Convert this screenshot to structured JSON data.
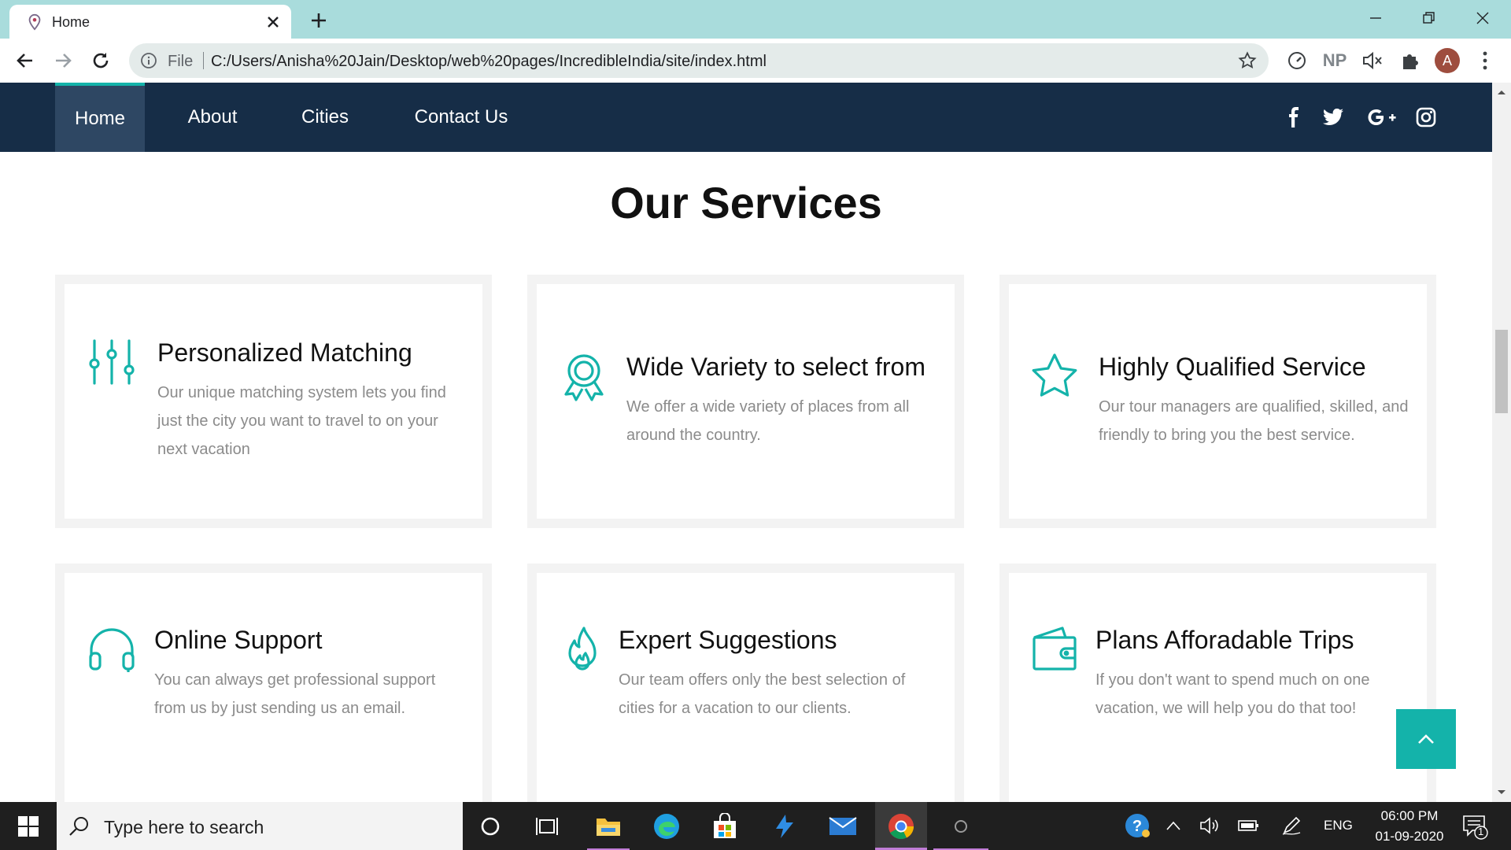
{
  "browser": {
    "tab_title": "Home",
    "omnibox_scheme": "File",
    "url": "C:/Users/Anisha%20Jain/Desktop/web%20pages/IncredibleIndia/site/index.html",
    "extension_np": "NP",
    "profile_initial": "A"
  },
  "nav": {
    "items": [
      {
        "label": "Home",
        "active": true
      },
      {
        "label": "About"
      },
      {
        "label": "Cities"
      },
      {
        "label": "Contact Us"
      }
    ],
    "social": [
      "facebook-icon",
      "twitter-icon",
      "google-plus-icon",
      "instagram-icon"
    ]
  },
  "services": {
    "title": "Our Services",
    "cards": [
      {
        "icon": "sliders-icon",
        "title": "Personalized Matching",
        "text": "Our unique matching system lets you find just the city you want to travel to on your next vacation"
      },
      {
        "icon": "award-ribbon-icon",
        "title": "Wide Variety to select from",
        "text": "We offer a wide variety of places from all around the country."
      },
      {
        "icon": "star-icon",
        "title": "Highly Qualified Service",
        "text": "Our tour managers are qualified, skilled, and friendly to bring you the best service."
      },
      {
        "icon": "headphones-icon",
        "title": "Online Support",
        "text": "You can always get professional support from us by just sending us an email."
      },
      {
        "icon": "fire-icon",
        "title": "Expert Suggestions",
        "text": "Our team offers only the best selection of cities for a vacation to our clients."
      },
      {
        "icon": "wallet-icon",
        "title": "Plans Afforadable Trips",
        "text": "If you don't want to spend much on one vacation, we will help you do that too!"
      }
    ]
  },
  "colors": {
    "accent": "#14b3aa",
    "navbar": "#162d47",
    "nav_active": "#2e4763",
    "tab_strip": "#a9dcdc"
  },
  "taskbar": {
    "search_placeholder": "Type here to search",
    "language": "ENG",
    "time": "06:00 PM",
    "date": "01-09-2020",
    "notification_count": "1"
  }
}
